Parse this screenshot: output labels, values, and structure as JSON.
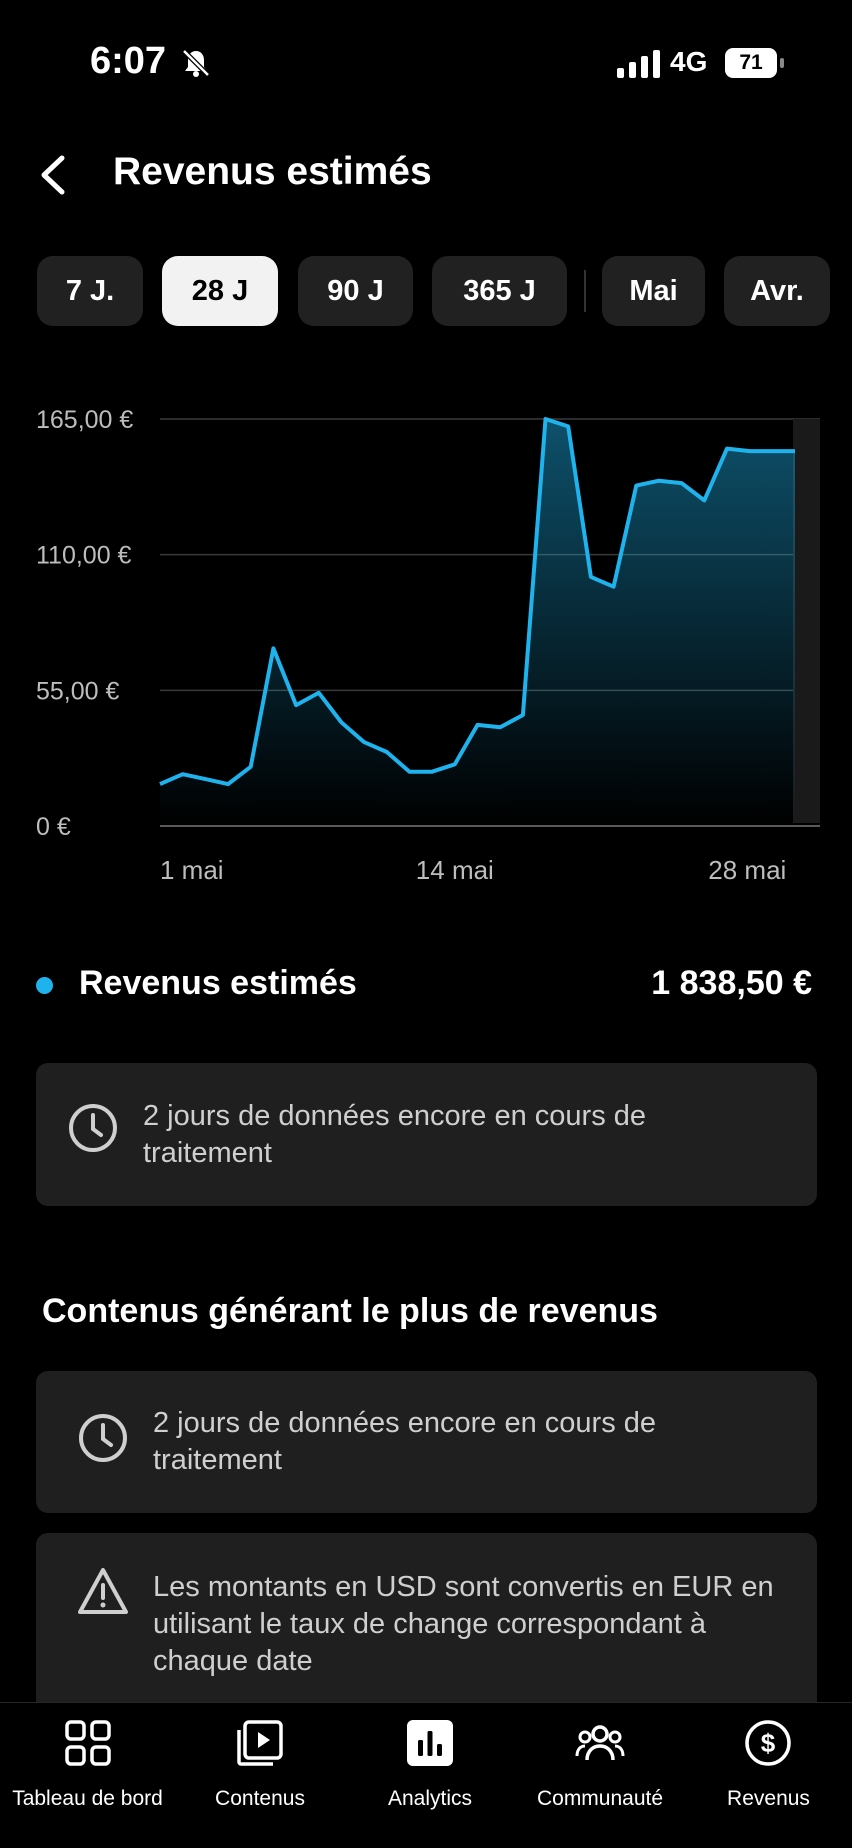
{
  "status_bar": {
    "time": "6:07",
    "network": "4G",
    "battery": "71"
  },
  "header": {
    "title": "Revenus estimés"
  },
  "period_tabs": [
    {
      "label": "7 J.",
      "active": false
    },
    {
      "label": "28 J",
      "active": true
    },
    {
      "label": "90 J",
      "active": false
    },
    {
      "label": "365 J",
      "active": false
    },
    {
      "label": "Mai",
      "active": false
    },
    {
      "label": "Avr.",
      "active": false
    }
  ],
  "chart_data": {
    "type": "area",
    "x_tick_labels": [
      "1 mai",
      "14 mai",
      "28 mai"
    ],
    "y_tick_labels": [
      "0 €",
      "55,00 €",
      "110,00 €",
      "165,00 €"
    ],
    "ylim": [
      0,
      165
    ],
    "grid": true,
    "series_color": "#1fb3ee",
    "series": [
      {
        "x": [
          1,
          2,
          3,
          4,
          5,
          6,
          7,
          8,
          9,
          10,
          11,
          12,
          13,
          14,
          15,
          16,
          17,
          18,
          19,
          20,
          21,
          22,
          23,
          24,
          25,
          26,
          27,
          28,
          29
        ],
        "values": [
          17,
          21,
          19,
          17,
          24,
          72,
          49,
          54,
          42,
          34,
          30,
          22,
          22,
          25,
          41,
          40,
          45,
          165,
          162,
          101,
          97,
          138,
          140,
          139,
          132,
          153,
          152,
          152,
          152
        ]
      }
    ]
  },
  "summary": {
    "label": "Revenus estimés",
    "value": "1 838,50 €"
  },
  "notice_1": {
    "text": "2 jours de données encore en cours de traitement"
  },
  "section": {
    "title": "Contenus générant le plus de revenus"
  },
  "notice_2": {
    "text": "2 jours de données encore en cours de traitement"
  },
  "notice_3": {
    "text": "Les montants en USD sont convertis en EUR en utilisant le taux de change correspondant à chaque date"
  },
  "bottom_nav": [
    {
      "label": "Tableau de bord",
      "icon": "dashboard-icon"
    },
    {
      "label": "Contenus",
      "icon": "content-icon"
    },
    {
      "label": "Analytics",
      "icon": "analytics-icon"
    },
    {
      "label": "Communauté",
      "icon": "community-icon"
    },
    {
      "label": "Revenus",
      "icon": "revenue-icon"
    }
  ]
}
